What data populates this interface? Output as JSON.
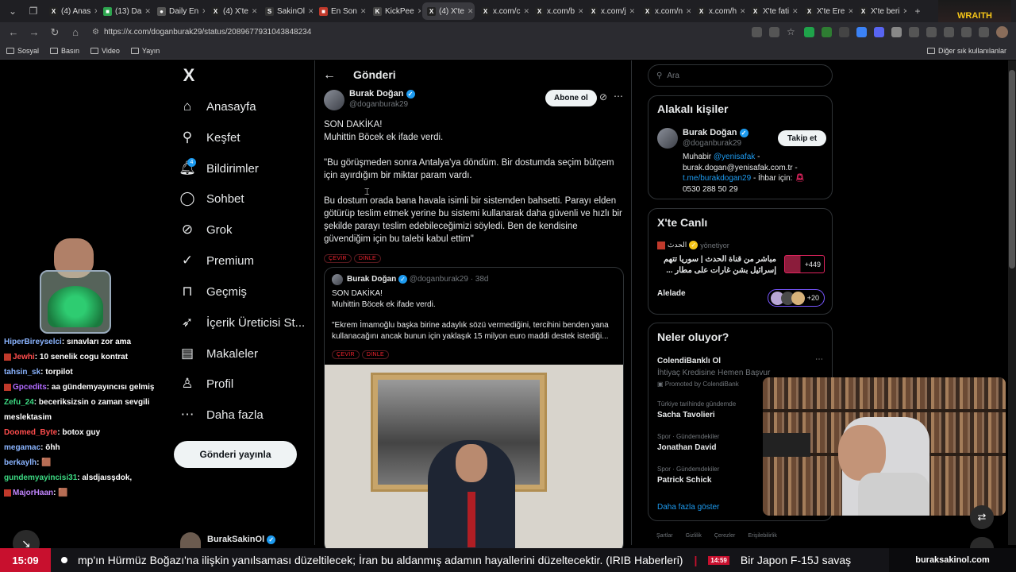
{
  "browser": {
    "tabs": [
      {
        "label": "(4) Anas",
        "fav": "X",
        "favcolor": "#222"
      },
      {
        "label": "(13) Da",
        "fav": "■",
        "favcolor": "#2da44e"
      },
      {
        "label": "Daily En",
        "fav": "●",
        "favcolor": "#555"
      },
      {
        "label": "(4) X'te",
        "fav": "X",
        "favcolor": "#222"
      },
      {
        "label": "SakinOl",
        "fav": "S",
        "favcolor": "#333"
      },
      {
        "label": "En Son",
        "fav": "■",
        "favcolor": "#c0392b"
      },
      {
        "label": "KickPee",
        "fav": "K",
        "favcolor": "#444"
      },
      {
        "label": "(4) X'te",
        "fav": "X",
        "favcolor": "#222"
      },
      {
        "label": "x.com/c",
        "fav": "X",
        "favcolor": "#222"
      },
      {
        "label": "x.com/b",
        "fav": "X",
        "favcolor": "#222"
      },
      {
        "label": "x.com/j",
        "fav": "X",
        "favcolor": "#222"
      },
      {
        "label": "x.com/n",
        "fav": "X",
        "favcolor": "#222"
      },
      {
        "label": "x.com/h",
        "fav": "X",
        "favcolor": "#222"
      },
      {
        "label": "X'te fati",
        "fav": "X",
        "favcolor": "#222"
      },
      {
        "label": "X'te Ere",
        "fav": "X",
        "favcolor": "#222"
      },
      {
        "label": "X'te beri",
        "fav": "X",
        "favcolor": "#222"
      }
    ],
    "url": "https://x.com/doganburak29/status/2089677931043848234",
    "bookmarks": [
      "Sosyal",
      "Basın",
      "Video",
      "Yayın"
    ],
    "other_bookmarks": "Diğer sık kullanılanlar",
    "wraith_label": "WRAITH"
  },
  "nav": {
    "logo": "X",
    "items": [
      {
        "label": "Anasayfa",
        "icon": "home-icon",
        "glyph": "⌂"
      },
      {
        "label": "Keşfet",
        "icon": "search-icon",
        "glyph": "⚲"
      },
      {
        "label": "Bildirimler",
        "icon": "bell-icon",
        "glyph": "🔔︎"
      },
      {
        "label": "Sohbet",
        "icon": "chat-icon",
        "glyph": "◯"
      },
      {
        "label": "Grok",
        "icon": "grok-icon",
        "glyph": "⊘"
      },
      {
        "label": "Premium",
        "icon": "premium-icon",
        "glyph": "✓"
      },
      {
        "label": "Geçmiş",
        "icon": "bookmark-icon",
        "glyph": "⊓"
      },
      {
        "label": "İçerik Üreticisi St...",
        "icon": "rocket-icon",
        "glyph": "➶"
      },
      {
        "label": "Makaleler",
        "icon": "article-icon",
        "glyph": "▤"
      },
      {
        "label": "Profil",
        "icon": "person-icon",
        "glyph": "♙"
      },
      {
        "label": "Daha fazla",
        "icon": "more-circle-icon",
        "glyph": "⋯"
      }
    ],
    "notif_badge": "4",
    "post_button": "Gönderi yayınla",
    "account_name": "BurakSakinOl"
  },
  "post": {
    "header": "Gönderi",
    "author_name": "Burak Doğan",
    "author_handle": "@doganburak29",
    "subscribe": "Abone ol",
    "line1": "SON DAKİKA!",
    "line2": "Muhittin Böcek ek ifade verdi.",
    "para1": "\"Bu görüşmeden sonra Antalya'ya döndüm. Bir dostumda seçim bütçem için ayırdığım bir miktar param vardı.",
    "para2": "Bu dostum orada bana havala isimli bir sistemden bahsetti. Parayı elden götürüp teslim etmek yerine bu sistemi kullanarak daha güvenli ve hızlı bir şekilde parayı teslim edebileceğimizi söyledi. Ben de kendisine güvendiğim için bu talebi kabul ettim\"",
    "translate": "ÇEVİR",
    "listen": "DİNLE"
  },
  "quote": {
    "author_name": "Burak Doğan",
    "author_handle": "@doganburak29",
    "time": "· 38d",
    "line1": "SON DAKİKA!",
    "line2": "Muhittin Böcek ek ifade verdi.",
    "para": "\"Ekrem İmamoğlu başka birine adaylık sözü vermediğini, tercihini benden yana kullanacağını ancak bunun için yaklaşık 15 milyon euro maddi destek istediği...",
    "translate": "ÇEVİR",
    "listen": "DİNLE"
  },
  "right": {
    "search_placeholder": "Ara",
    "related_title": "Alakalı kişiler",
    "person_name": "Burak Doğan",
    "person_handle": "@doganburak29",
    "follow": "Takip et",
    "bio1": "Muhabir ",
    "bio_link1": "@yenisafak",
    "bio2": " - burak.dogan@yenisafak.com.tr - ",
    "bio_link2": "t.me/burakdogan29",
    "bio3": " - İhbar için: ",
    "bio4": "0530 288 50 29",
    "live_title": "X'te Canlı",
    "live_host": "الحدث",
    "live_host_status": "yönetiyor",
    "live_text": "مباشر من قناة الحدث | سوريا تتهم إسرائيل بشن غارات على مطار ...",
    "live_count": "+449",
    "alelade": "Alelade",
    "alelade_count": "+20",
    "trends_title": "Neler oluyor?",
    "trend_ad_name": "ColendiBanklı Ol",
    "trend_ad_desc": "İhtiyaç Kredisine Hemen Başvur",
    "trend_ad_promo": "Promoted by ColendiBank",
    "trends": [
      {
        "context": "Türkiye tarihinde gündemde",
        "name": "Sacha Tavolieri"
      },
      {
        "context": "Spor · Gündemdekiler",
        "name": "Jonathan David"
      },
      {
        "context": "Spor · Gündemdekiler",
        "name": "Patrick Schick"
      }
    ],
    "show_more": "Daha fazla göster",
    "footer": [
      "Şartlar",
      "Gizlilik",
      "Çerezler",
      "Erişilebilirlik"
    ]
  },
  "chat": [
    {
      "user": "HiperBireyselci",
      "color": "#8ab4ff",
      "msg": "sınavları zor ama"
    },
    {
      "user": "Jewhi",
      "color": "#ff4d4d",
      "msg": "10 senelik cogu kontrat",
      "badge": true
    },
    {
      "user": "tahsin_sk",
      "color": "#8ab4ff",
      "msg": "torpilot"
    },
    {
      "user": "Gpcedits",
      "color": "#b26bff",
      "msg": "aa gündemyayıncısı gelmiş",
      "badge": true
    },
    {
      "user": "Zefu_24",
      "color": "#3ddc84",
      "msg": "beceriksizsin o zaman sevgili meslektasim"
    },
    {
      "user": "Doomed_Byte",
      "color": "#ff4d4d",
      "msg": "botox guy"
    },
    {
      "user": "megamac",
      "color": "#8ab4ff",
      "msg": "öhh"
    },
    {
      "user": "berkaylh",
      "color": "#8ab4ff",
      "msg": "🟫"
    },
    {
      "user": "gundemyayincisi31",
      "color": "#3ddc84",
      "msg": "alsdjaısşdok,"
    },
    {
      "user": "MajorHaan",
      "color": "#c084fc",
      "msg": "🟫",
      "badge": true
    }
  ],
  "ticker": {
    "time": "15:09",
    "text1": "mp'ın Hürmüz Boğazı'na ilişkin yanılsaması düzeltilecek; İran bu aldanmış adamın hayallerini düzeltecektir. (IRIB Haberleri)",
    "time2": "14:59",
    "text2": "Bir Japon F-15J savaş",
    "brand": "buraksakinol.com"
  }
}
